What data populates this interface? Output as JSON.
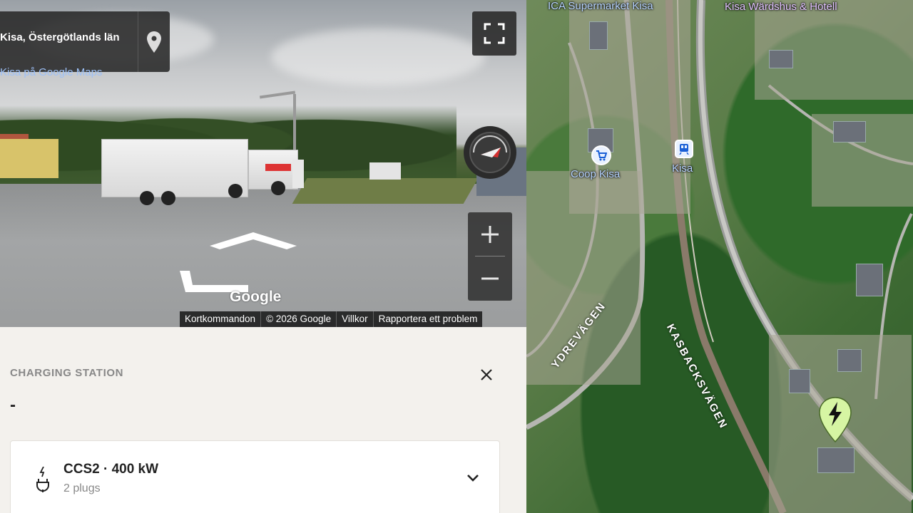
{
  "streetview": {
    "location_title": "Kisa, Östergötlands län",
    "location_link": "Kisa på Google Maps",
    "watermark": "Google",
    "attribution": [
      "Kortkommandon",
      "© 2026 Google",
      "Villkor",
      "Rapportera ett problem"
    ]
  },
  "station": {
    "type_label": "CHARGING STATION",
    "name": "-",
    "connector": {
      "title": "CCS2 · 400 kW",
      "subtitle": "2 plugs"
    }
  },
  "map": {
    "labels": {
      "ica": "ICA Supermarket Kisa",
      "wardshus": "Kisa Wärdshus & Hotell",
      "coop": "Coop Kisa",
      "station": "Kisa",
      "ydrevagen": "YDREVÄGEN",
      "kasbacksvagen": "KASBACKSVÄGEN"
    }
  },
  "colors": {
    "accent_link": "#9ec1f7",
    "charger_pin": "#d6f5a3",
    "panel_bg": "#f3f1ed"
  },
  "icons": [
    "location-pin-icon",
    "fullscreen-icon",
    "compass-icon",
    "zoom-in-icon",
    "zoom-out-icon",
    "close-icon",
    "plug-icon",
    "chevron-down-icon",
    "shopping-cart-icon",
    "train-icon",
    "lightning-icon"
  ]
}
